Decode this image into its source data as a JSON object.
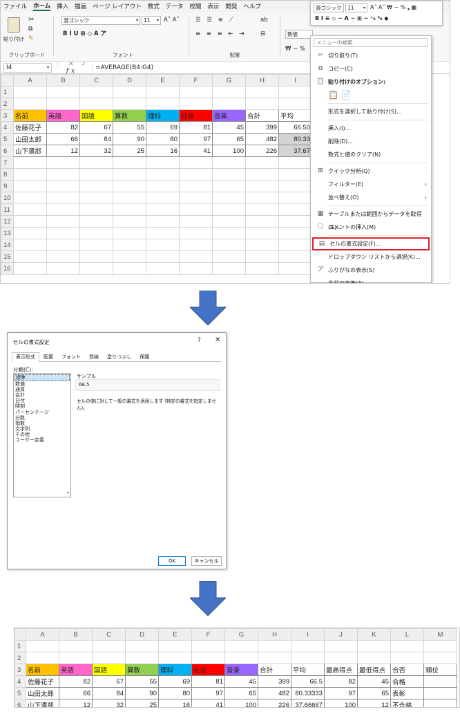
{
  "excel": {
    "menu": [
      "ファイル",
      "ホーム",
      "挿入",
      "描画",
      "ページ レイアウト",
      "数式",
      "データ",
      "校閲",
      "表示",
      "開発",
      "ヘルプ"
    ],
    "active_menu": "ホーム",
    "clipboard": {
      "paste_label": "貼り付け",
      "group": "クリップボード"
    },
    "font": {
      "name": "游ゴシック",
      "size": "11",
      "group": "フォント",
      "buttons": "B  I  U  ⊞  ◇  A  ア"
    },
    "align": {
      "group": "配置"
    },
    "number": {
      "format": "数値"
    },
    "name_box": "I4",
    "formula": "=AVERAGE(B4:G4)",
    "columns": [
      "A",
      "B",
      "C",
      "D",
      "E",
      "F",
      "G",
      "H",
      "I"
    ],
    "rows": [
      "1",
      "2",
      "3",
      "4",
      "5",
      "6",
      "7",
      "8",
      "9",
      "10",
      "11",
      "12",
      "13",
      "14",
      "15",
      "16"
    ],
    "headers": [
      "名前",
      "英語",
      "国語",
      "算数",
      "理科",
      "社会",
      "音楽",
      "合計",
      "平均"
    ],
    "header_colors": [
      "#ffc000",
      "#ff66cc",
      "#ffff00",
      "#92d050",
      "#00b0f0",
      "#ff0000",
      "#9966ff",
      "#ffffff",
      "#ffffff"
    ],
    "data": [
      [
        "佐藤花子",
        "82",
        "67",
        "55",
        "69",
        "81",
        "45",
        "399",
        "66.50"
      ],
      [
        "山田太郎",
        "66",
        "84",
        "90",
        "80",
        "97",
        "65",
        "482",
        "80.33"
      ],
      [
        "山下遣郎",
        "12",
        "32",
        "25",
        "16",
        "41",
        "100",
        "226",
        "37.67"
      ]
    ]
  },
  "minibar": {
    "font": "游ゴシック",
    "size": "11",
    "row1_rest": "A˄ A˅ ₩ ~ % ❟ ▦",
    "row2": "B  I  ≡  ◇ ~ A ~ ⊞ ~ ⁺₀ ⁰₀ ◆"
  },
  "context_menu": {
    "search_placeholder": "メニューの検索",
    "items": [
      {
        "label": "切り取り(T)",
        "icon": "✂"
      },
      {
        "label": "コピー(C)",
        "icon": "⧉"
      },
      {
        "label": "貼り付けのオプション:",
        "icon": "📋"
      },
      {
        "label": "形式を選択して貼り付け(S)...",
        "icon": ""
      },
      {
        "label": "挿入(I)...",
        "icon": ""
      },
      {
        "label": "削除(D)...",
        "icon": ""
      },
      {
        "label": "数式と値のクリア(N)",
        "icon": ""
      },
      {
        "label": "クイック分析(Q)",
        "icon": "⊞"
      },
      {
        "label": "フィルター(E)",
        "icon": ""
      },
      {
        "label": "並べ替え(O)",
        "icon": ""
      },
      {
        "label": "テーブルまたは範囲からデータを取得(G)...",
        "icon": "▦"
      },
      {
        "label": "コメントの挿入(M)",
        "icon": "🗨"
      },
      {
        "label": "セルの書式設定(F)...",
        "icon": "▤"
      },
      {
        "label": "ドロップダウン リストから選択(K)...",
        "icon": ""
      },
      {
        "label": "ふりがなの表示(S)",
        "icon": "ア"
      },
      {
        "label": "名前の定義(A)...",
        "icon": ""
      }
    ],
    "highlight_color": "#e02020"
  },
  "dialog": {
    "title": "セルの書式設定",
    "help": "?",
    "close": "✕",
    "tabs": [
      "表示形式",
      "配置",
      "フォント",
      "罫線",
      "塗りつぶし",
      "保護"
    ],
    "category_label": "分類(C):",
    "categories": [
      "標準",
      "数値",
      "通貨",
      "会計",
      "日付",
      "時刻",
      "パーセンテージ",
      "分数",
      "指数",
      "文字列",
      "その他",
      "ユーザー定義"
    ],
    "sample_label": "サンプル",
    "sample_value": "66.5",
    "description": "セルの値に対して一般の書式を適用します (特定の書式を指定しません)。",
    "ok": "OK",
    "cancel": "キャンセル"
  },
  "result": {
    "columns": [
      "A",
      "B",
      "C",
      "D",
      "E",
      "F",
      "G",
      "H",
      "I",
      "J",
      "K",
      "L",
      "M"
    ],
    "rows": [
      "1",
      "2",
      "3",
      "4",
      "5",
      "6"
    ],
    "headers": [
      "名前",
      "英語",
      "国語",
      "算数",
      "理科",
      "社会",
      "音楽",
      "合計",
      "平均",
      "最高得点",
      "最低得点",
      "合否",
      "順位"
    ],
    "data": [
      [
        "佐藤花子",
        "82",
        "67",
        "55",
        "69",
        "81",
        "45",
        "399",
        "66.5",
        "82",
        "45",
        "合格",
        ""
      ],
      [
        "山田太郎",
        "66",
        "84",
        "90",
        "80",
        "97",
        "65",
        "482",
        "80.33333",
        "97",
        "65",
        "表彰",
        ""
      ],
      [
        "山下遣郎",
        "12",
        "32",
        "25",
        "16",
        "41",
        "100",
        "226",
        "37.66667",
        "100",
        "12",
        "不合格",
        ""
      ]
    ]
  },
  "colors": {
    "arrow": "#4472c4",
    "arrow_edge": "#2f528f",
    "accent": "#1e7145"
  }
}
